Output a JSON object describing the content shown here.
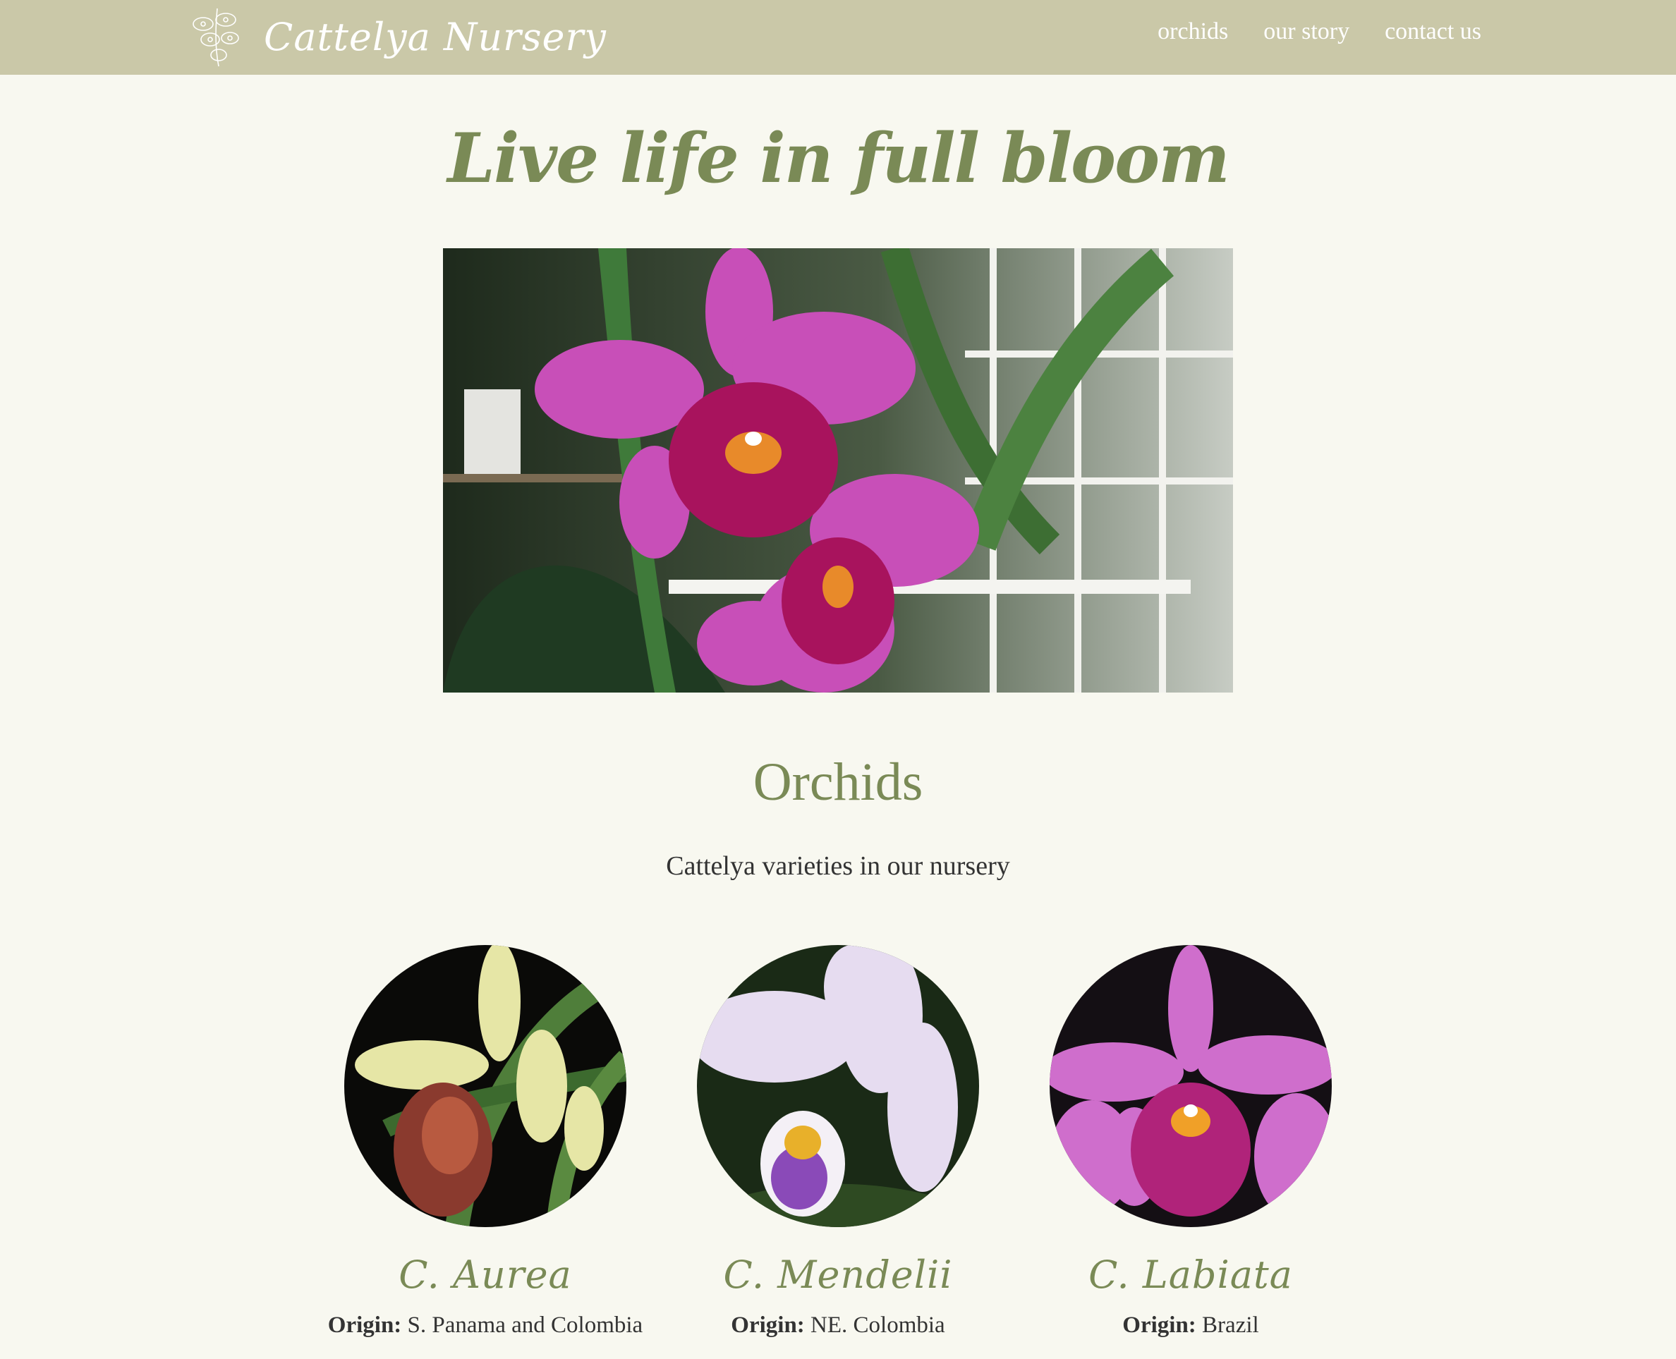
{
  "brand": {
    "name": "Cattelya Nursery"
  },
  "nav": {
    "orchids": "orchids",
    "story": "our story",
    "contact": "contact us"
  },
  "hero": {
    "title": "Live life in full bloom"
  },
  "section": {
    "title": "Orchids",
    "subtitle": "Cattelya varieties in our nursery"
  },
  "varieties": [
    {
      "name": "C. Aurea",
      "origin_label": "Origin:",
      "origin": "S. Panama and Colombia"
    },
    {
      "name": "C. Mendelii",
      "origin_label": "Origin:",
      "origin": "NE. Colombia"
    },
    {
      "name": "C. Labiata",
      "origin_label": "Origin:",
      "origin": "Brazil"
    }
  ],
  "colors": {
    "navbar": "#cac8a8",
    "accent": "#7a8a56",
    "background": "#f8f8f0"
  }
}
